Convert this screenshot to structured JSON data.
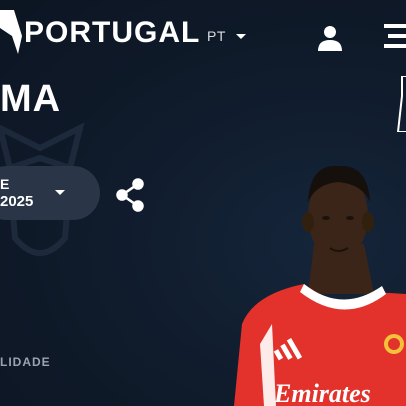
{
  "header": {
    "brand": "PORTUGAL",
    "language": "PT"
  },
  "player": {
    "name_fragment": "MA",
    "shirt_sponsor": "Emirates"
  },
  "season": {
    "label_fragment": "E",
    "value_fragment": "2025"
  },
  "stats": {
    "label_fragment": "LIDADE"
  },
  "icons": {
    "logo": "liga-portugal-logo-icon",
    "user": "user-icon",
    "menu": "menu-icon",
    "share": "share-icon",
    "crest": "club-crest-watermark-icon"
  },
  "colors": {
    "background": "#0f1a2a",
    "pill": "#2a3547",
    "jersey": "#e3322b"
  }
}
